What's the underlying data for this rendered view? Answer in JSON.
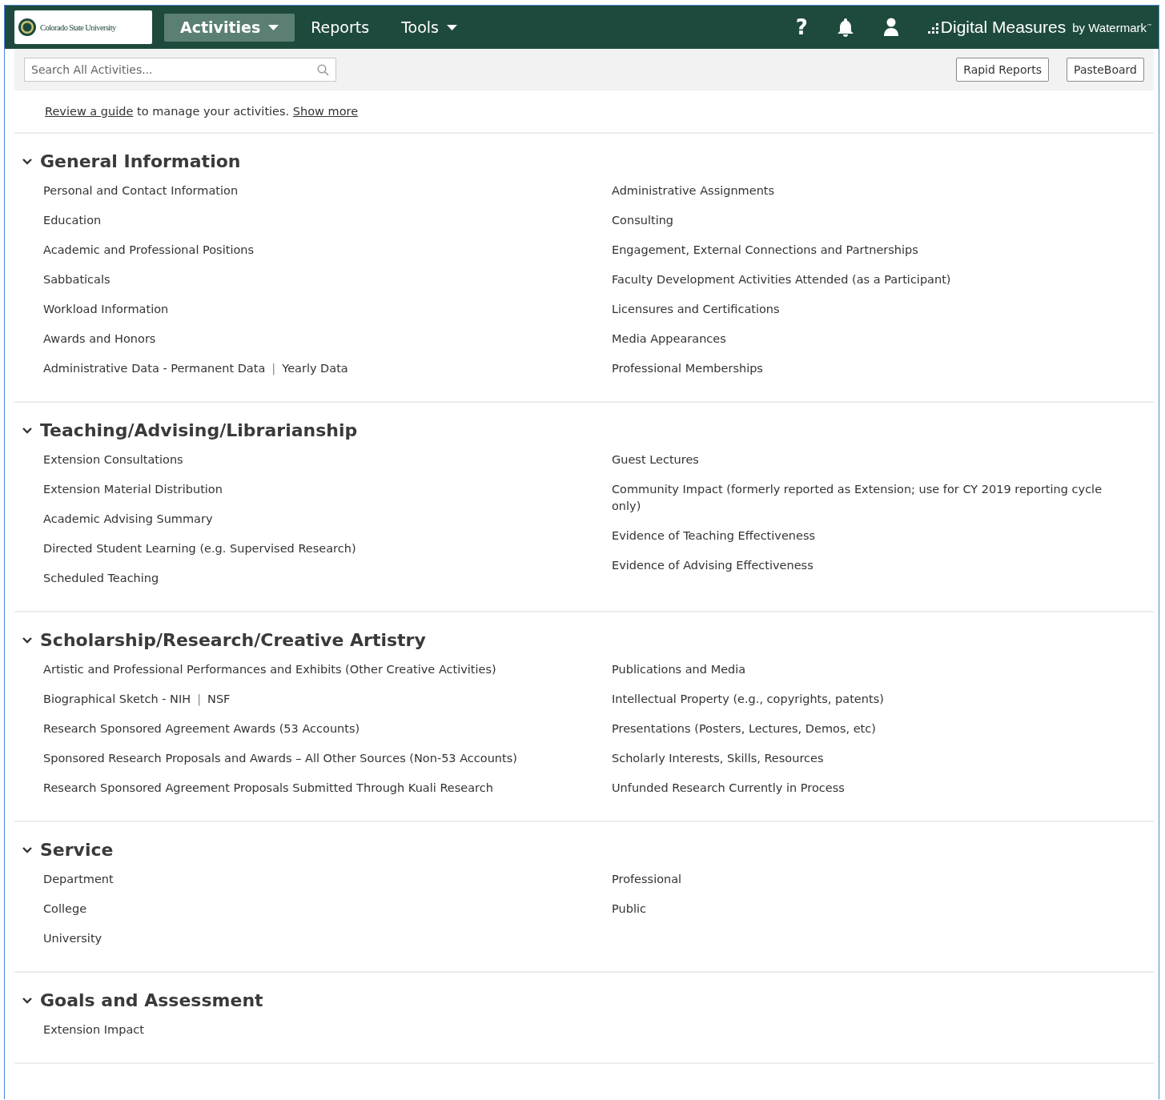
{
  "header": {
    "logo_text": "Colorado State University",
    "nav": [
      {
        "label": "Activities",
        "selected": true,
        "dropdown": true
      },
      {
        "label": "Reports",
        "selected": false,
        "dropdown": false
      },
      {
        "label": "Tools",
        "selected": false,
        "dropdown": true
      }
    ],
    "help": "?",
    "brand": "Digital Measures",
    "brand_suffix": "by Watermark",
    "brand_mark": "™"
  },
  "toolbar": {
    "search": {
      "placeholder": "Search All Activities..."
    },
    "buttons": [
      "Rapid Reports",
      "PasteBoard"
    ]
  },
  "intro": {
    "link": "Review a guide",
    "text": " to manage your activities. ",
    "more": "Show more"
  },
  "link_separator": "|",
  "sections": [
    {
      "title": "General Information",
      "expanded": true,
      "columns": [
        [
          {
            "links": [
              "Personal and Contact Information"
            ]
          },
          {
            "links": [
              "Education"
            ]
          },
          {
            "links": [
              "Academic and Professional Positions"
            ]
          },
          {
            "links": [
              "Sabbaticals"
            ]
          },
          {
            "links": [
              "Workload Information"
            ]
          },
          {
            "links": [
              "Awards and Honors"
            ]
          },
          {
            "links": [
              "Administrative Data - Permanent Data",
              "Yearly Data"
            ]
          }
        ],
        [
          {
            "links": [
              "Administrative Assignments"
            ]
          },
          {
            "links": [
              "Consulting"
            ]
          },
          {
            "links": [
              "Engagement, External Connections and Partnerships"
            ]
          },
          {
            "links": [
              "Faculty Development Activities Attended (as a Participant)"
            ]
          },
          {
            "links": [
              "Licensures and Certifications"
            ]
          },
          {
            "links": [
              "Media Appearances"
            ]
          },
          {
            "links": [
              "Professional Memberships"
            ]
          }
        ]
      ]
    },
    {
      "title": "Teaching/Advising/Librarianship",
      "expanded": true,
      "columns": [
        [
          {
            "links": [
              "Extension Consultations"
            ]
          },
          {
            "links": [
              "Extension Material Distribution"
            ]
          },
          {
            "links": [
              "Academic Advising Summary"
            ]
          },
          {
            "links": [
              "Directed Student Learning (e.g. Supervised Research)"
            ]
          },
          {
            "links": [
              "Scheduled Teaching"
            ]
          }
        ],
        [
          {
            "links": [
              "Guest Lectures"
            ]
          },
          {
            "links": [
              "Community Impact (formerly reported as Extension; use for CY 2019 reporting cycle only)"
            ]
          },
          {
            "links": [
              "Evidence of Teaching Effectiveness"
            ]
          },
          {
            "links": [
              "Evidence of Advising Effectiveness"
            ]
          }
        ]
      ]
    },
    {
      "title": "Scholarship/Research/Creative Artistry",
      "expanded": true,
      "columns": [
        [
          {
            "links": [
              "Artistic and Professional Performances and Exhibits (Other Creative Activities)"
            ]
          },
          {
            "links": [
              "Biographical Sketch - NIH",
              "NSF"
            ]
          },
          {
            "links": [
              "Research Sponsored Agreement Awards (53 Accounts)"
            ]
          },
          {
            "links": [
              "Sponsored Research Proposals and Awards – All Other Sources (Non-53 Accounts)"
            ]
          },
          {
            "links": [
              "Research Sponsored Agreement Proposals Submitted Through Kuali Research"
            ]
          }
        ],
        [
          {
            "links": [
              "Publications and Media"
            ]
          },
          {
            "links": [
              "Intellectual Property (e.g., copyrights, patents)"
            ]
          },
          {
            "links": [
              "Presentations (Posters, Lectures, Demos, etc)"
            ]
          },
          {
            "links": [
              "Scholarly Interests, Skills, Resources"
            ]
          },
          {
            "links": [
              "Unfunded Research Currently in Process"
            ]
          }
        ]
      ]
    },
    {
      "title": "Service",
      "expanded": true,
      "columns": [
        [
          {
            "links": [
              "Department"
            ]
          },
          {
            "links": [
              "College"
            ]
          },
          {
            "links": [
              "University"
            ]
          }
        ],
        [
          {
            "links": [
              "Professional"
            ]
          },
          {
            "links": [
              "Public"
            ]
          }
        ]
      ]
    },
    {
      "title": "Goals and Assessment",
      "expanded": true,
      "columns": [
        [
          {
            "links": [
              "Extension Impact"
            ]
          }
        ],
        []
      ]
    }
  ]
}
